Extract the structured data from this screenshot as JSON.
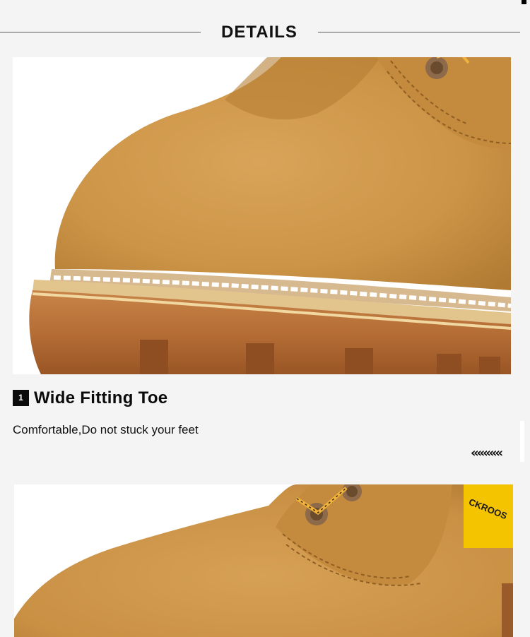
{
  "section": {
    "title": "DETAILS"
  },
  "feature": {
    "number": "1",
    "title": "Wide Fitting Toe",
    "description": "Comfortable,Do not stuck your feet",
    "arrows": "«««««"
  },
  "images": {
    "photo1": {
      "subject": "tan nubuck leather boot toe close-up with stitched gum rubber sole",
      "icon": "boot-toe-photo"
    },
    "photo2": {
      "subject": "tan nubuck leather boot upper with laces and brand heel tab",
      "icon": "boot-upper-photo",
      "tag_text": "CKROOS"
    }
  },
  "colors": {
    "background": "#f4f4f4",
    "leather": "#d09a4b",
    "sole": "#b9743c",
    "badge": "#0b0b0b",
    "brand_tag": "#f5c400"
  }
}
